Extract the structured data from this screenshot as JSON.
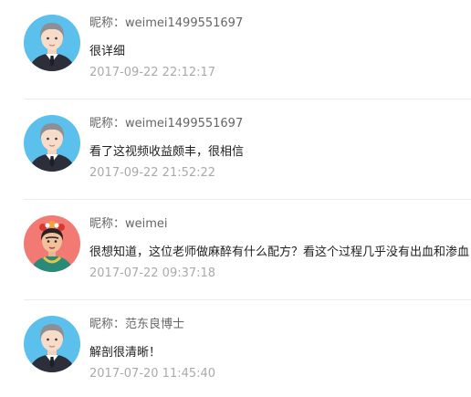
{
  "comments": [
    {
      "avatar": "man-avatar-icon",
      "nickname": "昵称：weimei1499551697",
      "content": "很详细",
      "time": "2017-09-22 22:12:17"
    },
    {
      "avatar": "man-avatar-icon",
      "nickname": "昵称：weimei1499551697",
      "content": "看了这视频收益颇丰，很相信",
      "time": "2017-09-22 21:52:22"
    },
    {
      "avatar": "woman-avatar-icon",
      "nickname": "昵称：weimei",
      "content": "很想知道，这位老师做麻醉有什么配方？看这个过程几乎没有出血和渗血！",
      "time": "2017-07-22 09:37:18"
    },
    {
      "avatar": "man-avatar-icon",
      "nickname": "昵称：范东良博士",
      "content": "解剖很清晰！",
      "time": "2017-07-20 11:45:40"
    }
  ],
  "colors": {
    "avatar_blue": "#5bc0eb",
    "avatar_coral": "#f27a73",
    "nickname": "#666666",
    "time": "#aaaaaa",
    "divider": "#ececec"
  }
}
